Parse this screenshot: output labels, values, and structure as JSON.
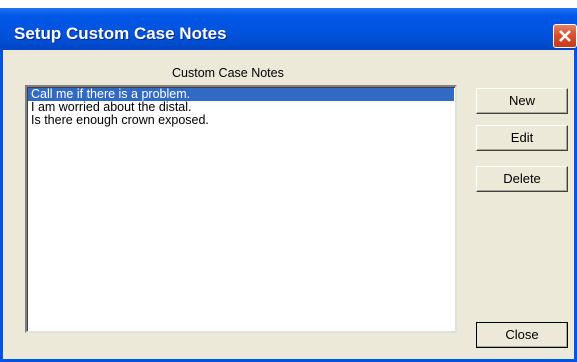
{
  "window": {
    "title": "Setup Custom Case Notes",
    "close_icon": "close-icon"
  },
  "notes": {
    "label": "Custom Case Notes",
    "items": [
      "Call me if there is a problem.",
      "I am worried about the distal.",
      "Is there enough crown exposed."
    ],
    "selected_index": 0
  },
  "buttons": {
    "new": "New",
    "edit": "Edit",
    "delete": "Delete",
    "close": "Close"
  },
  "colors": {
    "titlebar": "#0054e3",
    "selection": "#316ac5",
    "close_button": "#d9502e",
    "dialog_background": "#ece9d8"
  }
}
